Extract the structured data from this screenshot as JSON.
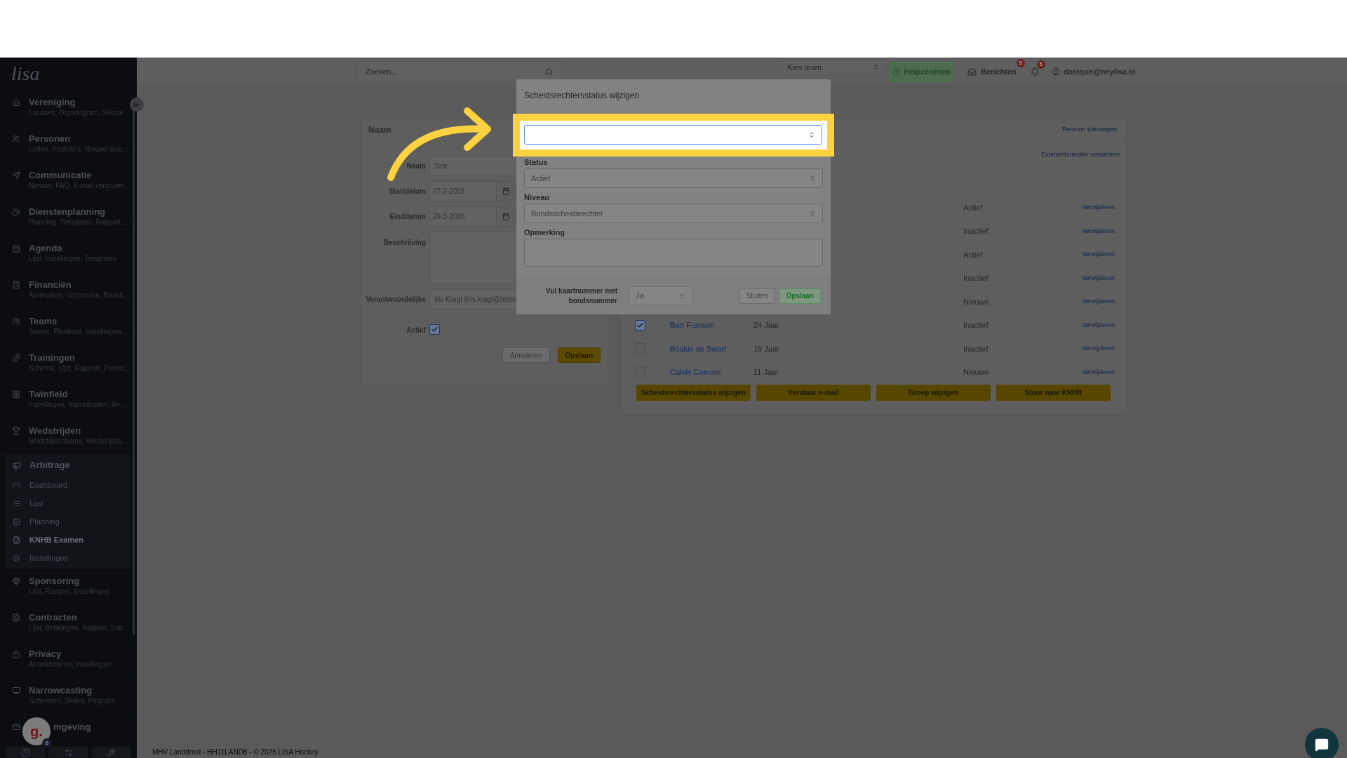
{
  "top_bar": {
    "search": {
      "placeholder": "Zoeken..."
    },
    "team_select": {
      "placeholder": "Kies team"
    },
    "help_button": "Helpcentrum",
    "messages": {
      "label": "Berichten",
      "badge": "5"
    },
    "notifications": {
      "badge": "5"
    },
    "user": "danique@heylisa.nl"
  },
  "sidebar": {
    "logo": "lisa",
    "items": [
      {
        "title": "Vereniging",
        "subtitle": "Locaties, Organogram, Seizoe…"
      },
      {
        "title": "Personen",
        "subtitle": "Leden, Pasfoto's, Nieuwe insc…"
      },
      {
        "title": "Communicatie",
        "subtitle": "Nieuws, FAQ, E-mail versturen…"
      },
      {
        "title": "Dienstenplanning",
        "subtitle": "Planning, Templates, Rapport,…"
      },
      {
        "title": "Agenda",
        "subtitle": "Lijst, Instellingen, Templates"
      },
      {
        "title": "Financiën",
        "subtitle": "Aanmaken, Verzenden, Bankb…"
      },
      {
        "title": "Teams",
        "subtitle": "Teams, Planbord, Instellingen,…"
      },
      {
        "title": "Trainingen",
        "subtitle": "Schema, Lijst, Rapport, Period…"
      },
      {
        "title": "Twinfield",
        "subtitle": "Instellingen, Importfouten, Be…"
      },
      {
        "title": "Wedstrijden",
        "subtitle": "Wedstrijdschema, Wedstrijdpl…"
      },
      {
        "title": "Arbitrage",
        "expanded": true,
        "children": [
          {
            "title": "Dashboard",
            "selected": false
          },
          {
            "title": "Lijst",
            "selected": false
          },
          {
            "title": "Planning",
            "selected": false
          },
          {
            "title": "KNHB Examen",
            "selected": true
          },
          {
            "title": "Instellingen",
            "selected": false
          }
        ]
      },
      {
        "title": "Sponsoring",
        "subtitle": "Lijst, Rapport, Instellingen"
      },
      {
        "title": "Contracten",
        "subtitle": "Lijst, Betalingen, Rapport, Inst…"
      },
      {
        "title": "Privacy",
        "subtitle": "Anonimiseren, Instellingen"
      },
      {
        "title": "Narrowcasting",
        "subtitle": "Schermen, Slides, Pagina's"
      },
      {
        "title": "mgeving"
      }
    ]
  },
  "assistant": {
    "letter": "g.",
    "badge": "8"
  },
  "event_form": {
    "header": "Naam",
    "fields": [
      {
        "kind": "text",
        "label": "Naam",
        "value": "Test"
      },
      {
        "kind": "date",
        "label": "Startdatum",
        "value": "27-2-2025"
      },
      {
        "kind": "date",
        "label": "Einddatum",
        "value": "29-3-2025"
      },
      {
        "kind": "textarea",
        "label": "Beschrijving"
      },
      {
        "kind": "text",
        "label": "Verantwoordelijke",
        "value": "Iris Kragt (iris.kragt@hotm"
      },
      {
        "kind": "checkbox",
        "label": "Actief",
        "checked": true
      }
    ],
    "buttons": [
      {
        "label": "Annuleren",
        "kind": "default"
      },
      {
        "label": "Opslaan",
        "kind": "warning"
      }
    ]
  },
  "referees": {
    "header_link": "Persoon toevoegen",
    "exam_link": "Examenformulier verwerken",
    "rows": [
      {
        "status": "Actief",
        "action": "Verwijderen"
      },
      {
        "status": "Inactief",
        "action": "Verwijderen"
      },
      {
        "status": "Actief",
        "action": "Verwijderen"
      },
      {
        "status": "Inactief",
        "action": "Verwijderen"
      },
      {
        "status": "Nieuwe",
        "action": "Verwijderen"
      },
      {
        "checked": true,
        "name": "Bart Fransen",
        "age": "24 Jaar",
        "status": "Inactief",
        "action": "Verwijderen"
      },
      {
        "checked": false,
        "name": "Boukje de Swart",
        "age": "19 Jaar",
        "status": "Inactief",
        "action": "Verwijderen"
      },
      {
        "checked": false,
        "name": "Calvin Coenen",
        "age": "11 Jaar",
        "status": "Nieuwe",
        "action": "Verwijderen"
      }
    ],
    "actions": [
      "Scheidsrechtersstatus wijzigen",
      "Verstuur e-mail",
      "Groep wijzigen",
      "Stuur naar KNHB"
    ]
  },
  "modal": {
    "title": "Scheidsrechtersstatus wijzigen",
    "fields": [
      {
        "kind": "select",
        "highlighted": true
      },
      {
        "kind": "select",
        "label": "Status",
        "value": "Actief",
        "highlighted": false
      },
      {
        "kind": "select",
        "label": "Niveau",
        "value": "Bondsscheidsrechter",
        "highlighted": false
      },
      {
        "kind": "textarea",
        "label": "Opmerking",
        "highlighted": false
      }
    ],
    "footer": {
      "label": "Vul kaartnummer met bondsnummer",
      "select": "Ja",
      "buttons": [
        {
          "label": "Sluiten",
          "kind": "default"
        },
        {
          "label": "Opslaan",
          "kind": "success"
        }
      ]
    }
  },
  "footer": "MHV Landdrost - HH11LAND8 - © 2025 LISA Hockey"
}
